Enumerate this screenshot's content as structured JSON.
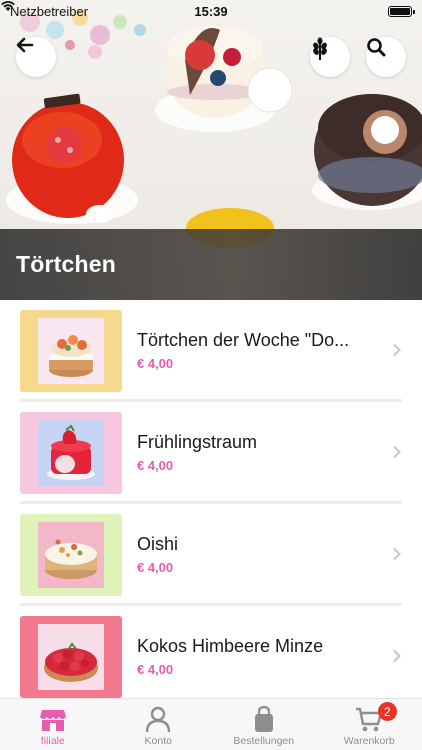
{
  "status_bar": {
    "carrier": "Netzbetreiber",
    "time": "15:39"
  },
  "page": {
    "title": "Törtchen"
  },
  "products": [
    {
      "name": "Törtchen der Woche \"Do...",
      "price": "€ 4,00",
      "thumb_color": "#f7d98e"
    },
    {
      "name": "Frühlingstraum",
      "price": "€ 4,00",
      "thumb_color": "#f7c6df"
    },
    {
      "name": "Oishi",
      "price": "€ 4,00",
      "thumb_color": "#dff2b9"
    },
    {
      "name": "Kokos Himbeere Minze",
      "price": "€ 4,00",
      "thumb_color": "#f2788e"
    }
  ],
  "tabbar": {
    "tabs": [
      {
        "label": "filiale",
        "icon": "store-icon",
        "active": true
      },
      {
        "label": "Konto",
        "icon": "person-icon",
        "active": false
      },
      {
        "label": "Bestellungen",
        "icon": "bag-icon",
        "active": false
      },
      {
        "label": "Warenkorb",
        "icon": "cart-icon",
        "active": false
      }
    ],
    "cart_badge": "2"
  },
  "colors": {
    "accent": "#e85cae",
    "badge": "#e5342b"
  }
}
